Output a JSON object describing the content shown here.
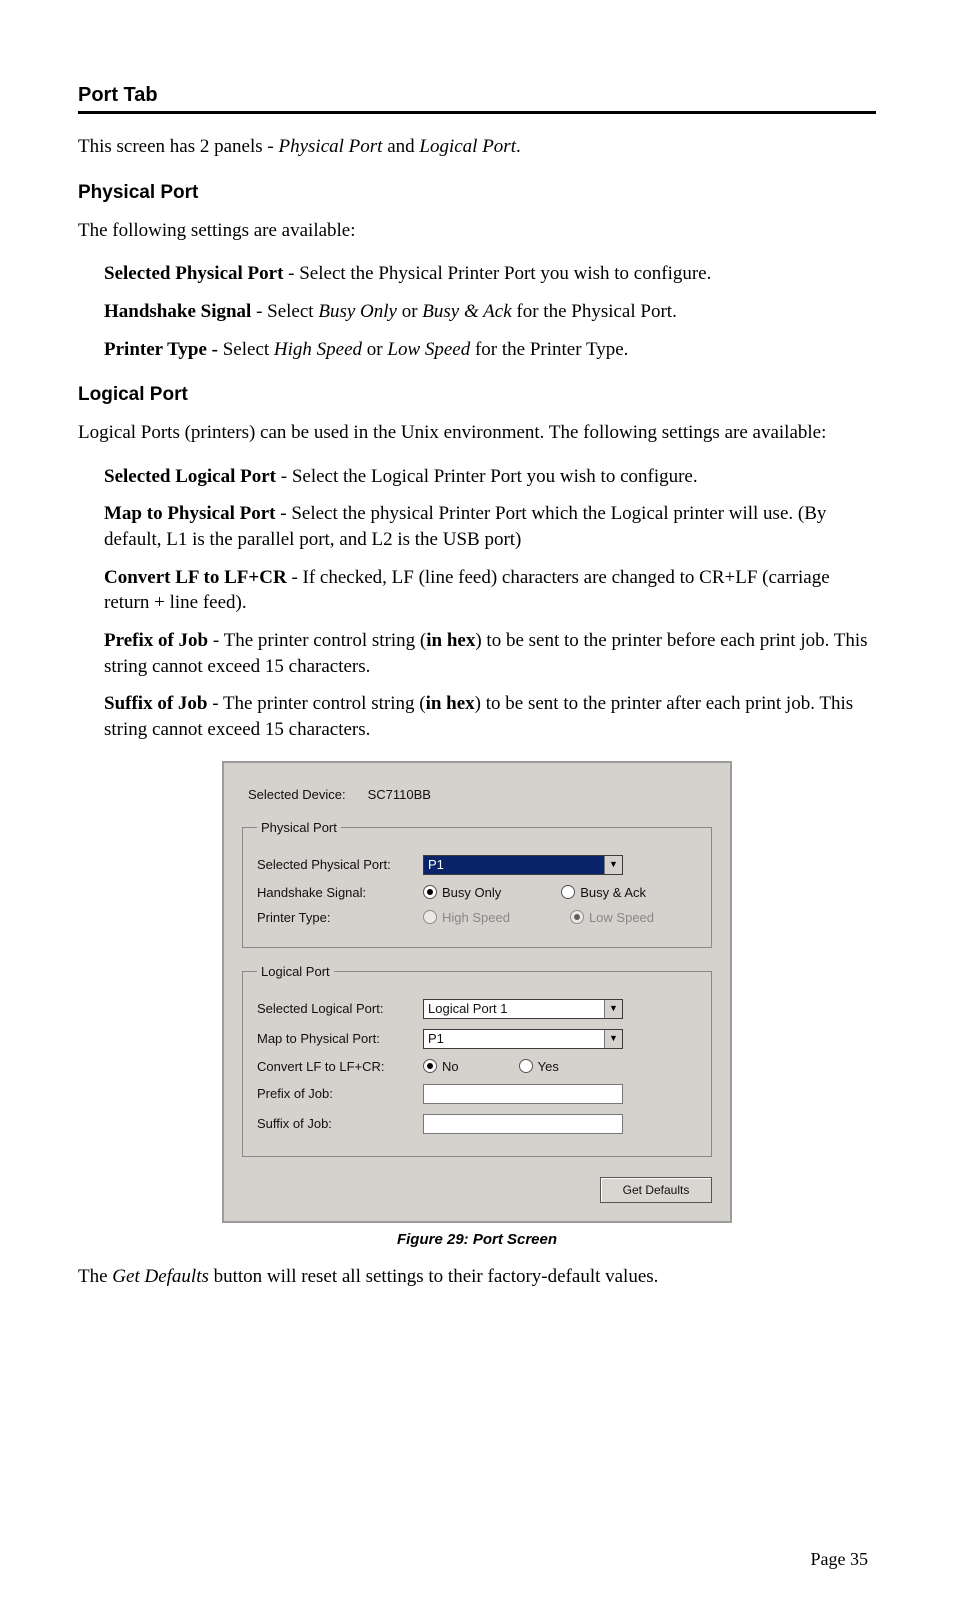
{
  "headings": {
    "port_tab": "Port Tab",
    "intro_plain_1": "This screen has 2 panels - ",
    "intro_em_1": "Physical Port",
    "intro_plain_2": " and ",
    "intro_em_2": "Logical Port",
    "intro_plain_3": ".",
    "physical_port": "Physical Port",
    "physical_intro": "The following settings are available:",
    "logical_port": "Logical Port",
    "logical_intro": "Logical Ports (printers) can be used in the Unix environment. The following settings are available:"
  },
  "phys_items": {
    "selected_b": "Selected Physical Port",
    "selected_t": " - Select the Physical Printer Port you wish to configure.",
    "hand_b": "Handshake Signal",
    "hand_t1": " - Select ",
    "hand_e1": "Busy Only",
    "hand_t2": " or ",
    "hand_e2": "Busy & Ack",
    "hand_t3": " for the Physical Port.",
    "ptype_b": "Printer Type - ",
    "ptype_t1": "Select ",
    "ptype_e1": "High Speed",
    "ptype_t2": " or ",
    "ptype_e2": "Low Speed",
    "ptype_t3": " for the Printer Type."
  },
  "log_items": {
    "sel_b": "Selected Logical Port",
    "sel_t": " - Select the Logical Printer Port you wish to configure.",
    "map_b": "Map to Physical Port",
    "map_t": " - Select the physical Printer Port which the Logical printer will use. (By default, L1 is the parallel port, and L2 is the USB port)",
    "conv_b": "Convert LF to LF+CR",
    "conv_t": " - If checked, LF (line feed) characters are changed to CR+LF (carriage return + line feed).",
    "pre_b": "Prefix of Job",
    "pre_t1": " - The printer control string (",
    "pre_bi": "in hex",
    "pre_t2": ") to be sent to the printer before each print job. This string cannot exceed 15 characters.",
    "suf_b": "Suffix of Job",
    "suf_t1": " - The printer control string (",
    "suf_bi": "in hex",
    "suf_t2": ") to be sent to the printer after each print job. This string cannot exceed 15 characters."
  },
  "dialog": {
    "device_label": "Selected Device:",
    "device_value": "SC7110BB",
    "phys_group": "Physical Port",
    "phys_sel_label": "Selected Physical Port:",
    "phys_sel_value": "P1",
    "hand_label": "Handshake Signal:",
    "hand_opt1": "Busy Only",
    "hand_opt2": "Busy & Ack",
    "ptype_label": "Printer Type:",
    "ptype_opt1": "High Speed",
    "ptype_opt2": "Low Speed",
    "log_group": "Logical Port",
    "log_sel_label": "Selected Logical Port:",
    "log_sel_value": "Logical Port 1",
    "map_label": "Map to Physical Port:",
    "map_value": "P1",
    "conv_label": "Convert LF to LF+CR:",
    "conv_opt1": "No",
    "conv_opt2": "Yes",
    "pre_label": "Prefix of Job:",
    "pre_value": "",
    "suf_label": "Suffix of Job:",
    "suf_value": "",
    "btn_get": "Get Defaults"
  },
  "caption": "Figure 29: Port Screen",
  "closing_1": "The ",
  "closing_em": "Get Defaults",
  "closing_2": " button will reset all settings to their factory-default values.",
  "page_num": "Page 35"
}
